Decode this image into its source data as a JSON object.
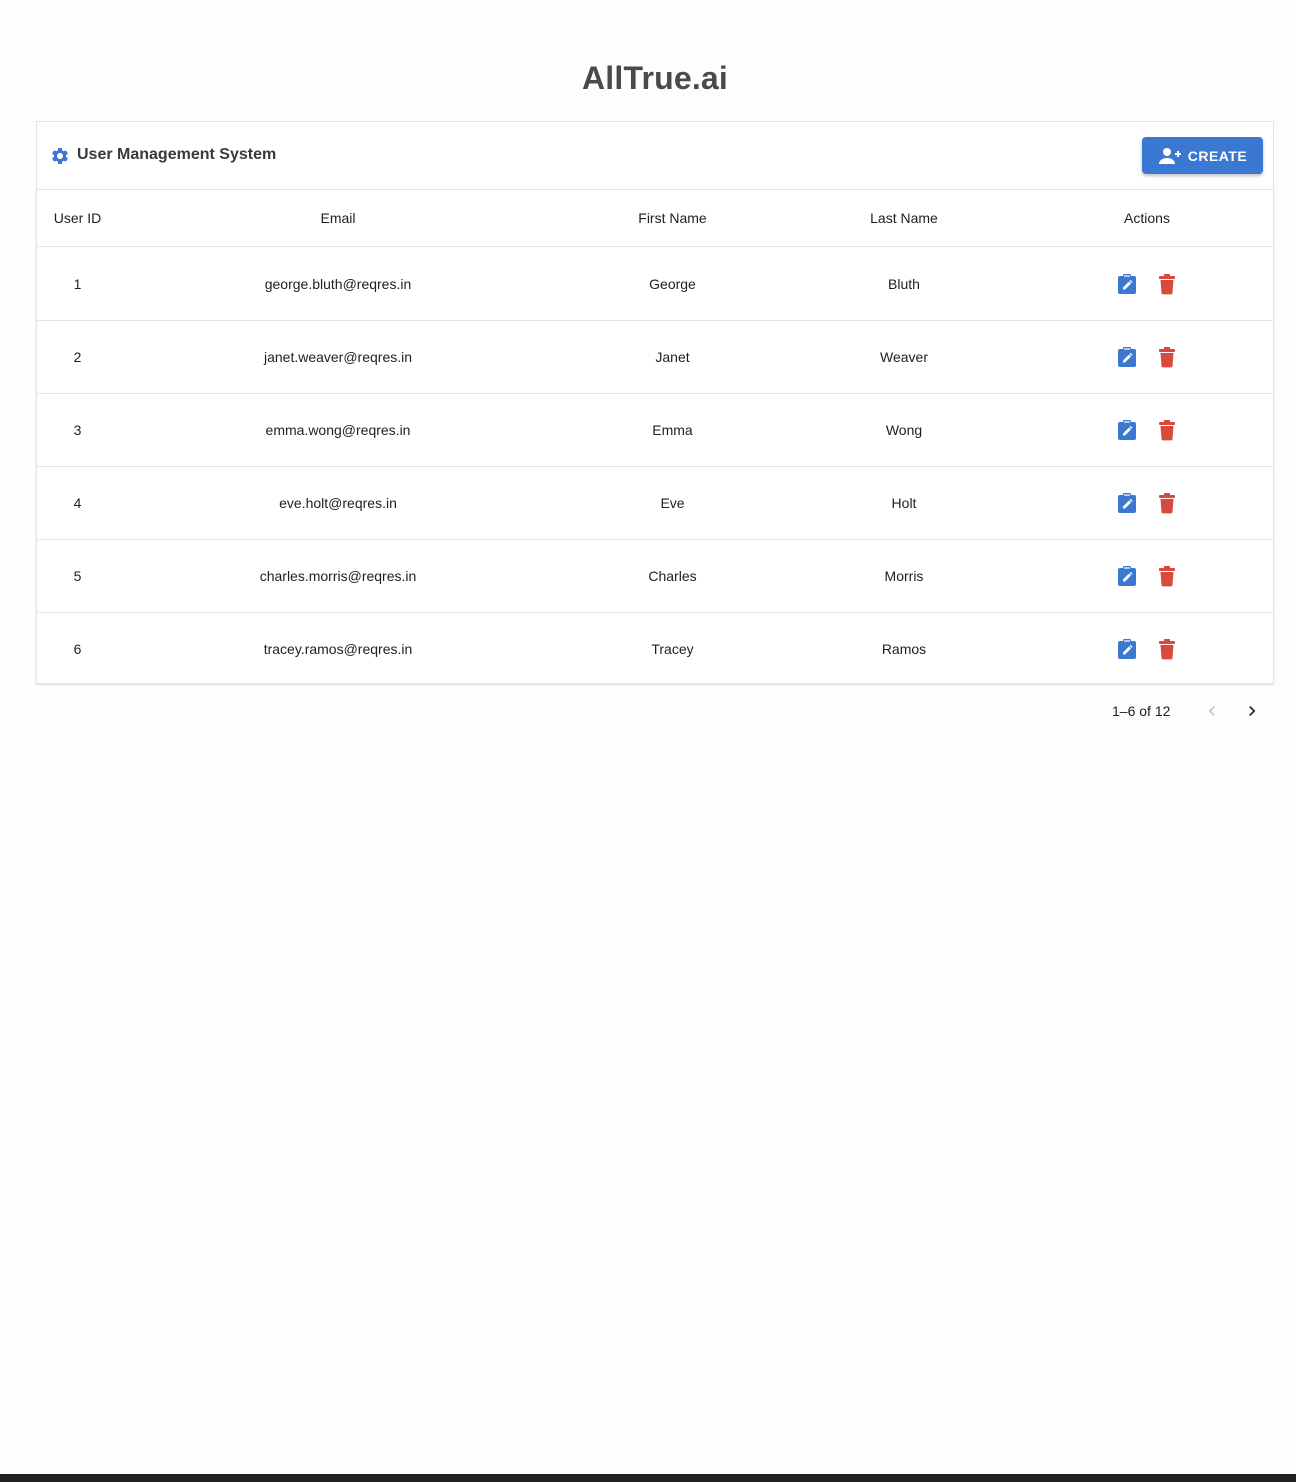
{
  "app": {
    "title": "AllTrue.ai"
  },
  "panel": {
    "title": "User Management System",
    "icon": "gear-icon",
    "create_label": "CREATE",
    "accent_color": "#3a78d1"
  },
  "table": {
    "columns": {
      "id": "User ID",
      "email": "Email",
      "first": "First Name",
      "last": "Last Name",
      "actions": "Actions"
    },
    "rows": [
      {
        "id": "1",
        "email": "george.bluth@reqres.in",
        "first": "George",
        "last": "Bluth"
      },
      {
        "id": "2",
        "email": "janet.weaver@reqres.in",
        "first": "Janet",
        "last": "Weaver"
      },
      {
        "id": "3",
        "email": "emma.wong@reqres.in",
        "first": "Emma",
        "last": "Wong"
      },
      {
        "id": "4",
        "email": "eve.holt@reqres.in",
        "first": "Eve",
        "last": "Holt"
      },
      {
        "id": "5",
        "email": "charles.morris@reqres.in",
        "first": "Charles",
        "last": "Morris"
      },
      {
        "id": "6",
        "email": "tracey.ramos@reqres.in",
        "first": "Tracey",
        "last": "Ramos"
      }
    ],
    "edit_icon": "edit-clipboard-icon",
    "delete_icon": "trash-icon",
    "edit_color": "#3a78d1",
    "delete_color": "#d94a3d"
  },
  "pagination": {
    "label": "1–6 of 12",
    "prev_icon": "chevron-left-icon",
    "next_icon": "chevron-right-icon"
  }
}
